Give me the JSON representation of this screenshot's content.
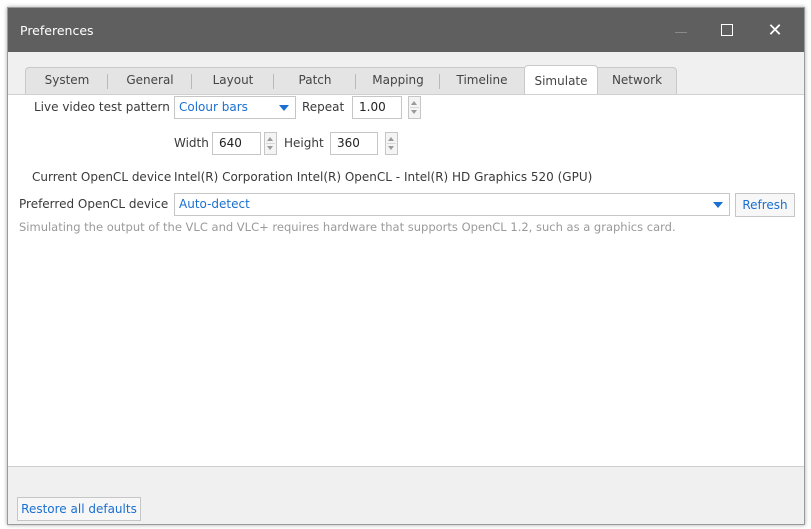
{
  "window": {
    "title": "Preferences"
  },
  "tabs": [
    {
      "label": "System"
    },
    {
      "label": "General"
    },
    {
      "label": "Layout"
    },
    {
      "label": "Patch"
    },
    {
      "label": "Mapping"
    },
    {
      "label": "Timeline"
    },
    {
      "label": "Simulate",
      "active": true
    },
    {
      "label": "Network"
    }
  ],
  "simulate": {
    "live_video_label": "Live video test pattern",
    "pattern_value": "Colour bars",
    "repeat_label": "Repeat",
    "repeat_value": "1.00",
    "width_label": "Width",
    "width_value": "640",
    "height_label": "Height",
    "height_value": "360",
    "current_device_label": "Current OpenCL device",
    "current_device_value": "Intel(R) Corporation Intel(R) OpenCL - Intel(R) HD Graphics 520 (GPU)",
    "preferred_device_label": "Preferred OpenCL device",
    "preferred_device_value": "Auto-detect",
    "refresh_label": "Refresh",
    "hint": "Simulating the output of the VLC and VLC+ requires hardware that supports OpenCL 1.2, such as a graphics card."
  },
  "footer": {
    "restore_label": "Restore all defaults"
  },
  "colors": {
    "accent": "#1a6fd1",
    "titlebar": "#5f5f5f"
  }
}
